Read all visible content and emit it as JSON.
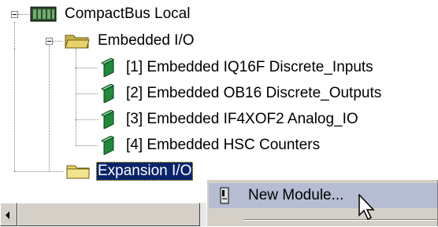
{
  "tree": {
    "root": {
      "label": "CompactBus Local"
    },
    "embedded": {
      "label": "Embedded I/O"
    },
    "modules": [
      {
        "label": "[1] Embedded IQ16F Discrete_Inputs"
      },
      {
        "label": "[2] Embedded OB16 Discrete_Outputs"
      },
      {
        "label": "[3] Embedded IF4XOF2 Analog_IO"
      },
      {
        "label": "[4] Embedded HSC Counters"
      }
    ],
    "expansion": {
      "label": "Expansion I/O"
    }
  },
  "context_menu": {
    "items": [
      {
        "label": "New Module...",
        "icon": "module-icon"
      }
    ]
  },
  "colors": {
    "selection": "#0a246a",
    "menu_highlight": "#b6bdd2",
    "module_green": "#1f8a3a",
    "folder_yellow": "#e8d36a"
  }
}
